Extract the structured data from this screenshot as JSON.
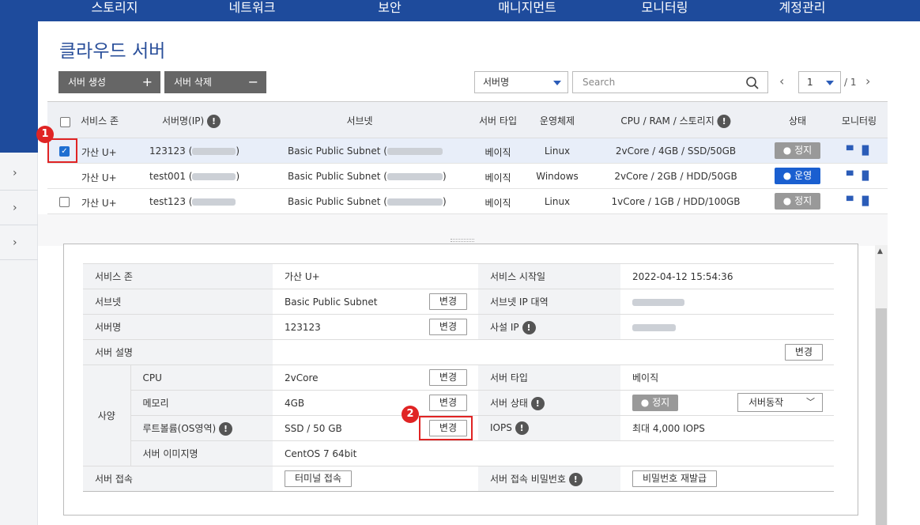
{
  "topnav": [
    "스토리지",
    "네트워크",
    "보안",
    "매니지먼트",
    "모니터링",
    "계정관리"
  ],
  "page_title": "클라우드 서버",
  "toolbar": {
    "create_label": "서버 생성",
    "create_sym": "+",
    "delete_label": "서버 삭제",
    "delete_sym": "−"
  },
  "filter": {
    "field": "서버명",
    "search_placeholder": "Search"
  },
  "pager": {
    "page": "1",
    "total": "/ 1",
    "prev": "‹",
    "next": "›"
  },
  "table": {
    "headers": [
      "서비스 존",
      "서버명(IP)",
      "서브넷",
      "서버 타입",
      "운영체제",
      "CPU / RAM / 스토리지",
      "상태",
      "모니터링"
    ],
    "rows": [
      {
        "zone": "가산 U+",
        "name": "123123 (",
        "name_end": ")",
        "subnet": "Basic Public Subnet (",
        "subnet_end": "",
        "type": "베이직",
        "os": "Linux",
        "spec": "2vCore / 4GB / SSD/50GB",
        "status": "정지",
        "checked": true
      },
      {
        "zone": "가산 U+",
        "name": "test001 (",
        "name_end": ")",
        "subnet": "Basic Public Subnet (",
        "subnet_end": ")",
        "type": "베이직",
        "os": "Windows",
        "spec": "2vCore / 2GB / HDD/50GB",
        "status": "운영",
        "checked": false
      },
      {
        "zone": "가산 U+",
        "name": "test123 (",
        "name_end": "",
        "subnet": "Basic Public Subnet (",
        "subnet_end": ")",
        "type": "베이직",
        "os": "Linux",
        "spec": "1vCore / 1GB / HDD/100GB",
        "status": "정지",
        "checked": false
      }
    ]
  },
  "detail": {
    "zone_label": "서비스 존",
    "zone": "가산 U+",
    "start_label": "서비스 시작일",
    "start": "2022-04-12 15:54:36",
    "subnet_label": "서브넷",
    "subnet": "Basic Public Subnet",
    "subnet_ip_label": "서브넷 IP 대역",
    "name_label": "서버명",
    "name": "123123",
    "private_ip_label": "사설 IP",
    "desc_label": "서버 설명",
    "spec_label": "사양",
    "cpu_label": "CPU",
    "cpu": "2vCore",
    "type_label": "서버 타입",
    "type": "베이직",
    "mem_label": "메모리",
    "mem": "4GB",
    "state_label": "서버 상태",
    "state": "정지",
    "action": "서버동작",
    "root_label": "루트볼륨(OS영역)",
    "root": "SSD / 50 GB",
    "iops_label": "IOPS",
    "iops": "최대 4,000 IOPS",
    "image_label": "서버 이미지명",
    "image": "CentOS 7 64bit",
    "access_label": "서버 접속",
    "terminal": "터미널 접속",
    "pw_label": "서버 접속 비밀번호",
    "pw_reissue": "비밀번호 재발급",
    "change": "변경"
  },
  "annotations": [
    "1",
    "2"
  ],
  "colors": {
    "nav": "#1e4b9c",
    "run": "#1a5fd0",
    "stop": "#999999",
    "annotation": "#e02424"
  }
}
